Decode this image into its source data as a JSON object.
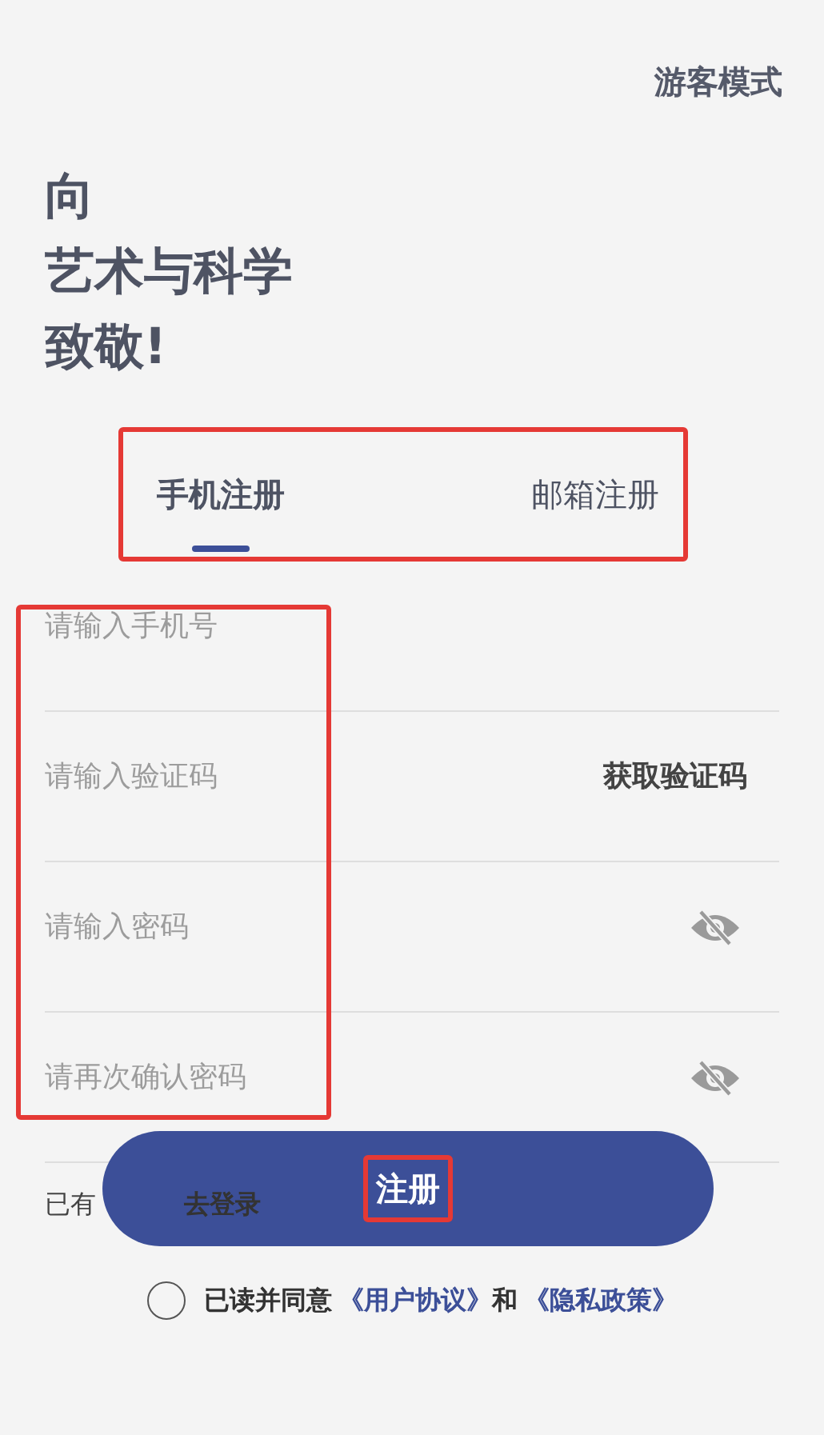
{
  "guest_mode": "游客模式",
  "headline": [
    "向",
    "艺术与科学",
    "致敬!"
  ],
  "tabs_highlighted": true,
  "tabs": [
    {
      "label": "手机注册",
      "selected": true
    },
    {
      "label": "邮箱注册",
      "selected": false
    }
  ],
  "fields_highlighted": true,
  "fields": [
    {
      "kind": "text",
      "placeholder": "请输入手机号"
    },
    {
      "kind": "code",
      "placeholder": "请输入验证码",
      "action": "获取验证码"
    },
    {
      "kind": "password",
      "placeholder": "请输入密码"
    },
    {
      "kind": "password",
      "placeholder": "请再次确认密码"
    }
  ],
  "login_prompt": "已有",
  "login_link": "去登录",
  "register_button": {
    "label": "注册",
    "highlighted": true
  },
  "agreement": {
    "checked": false,
    "text": "已读并同意",
    "link_1": "《用户协议》",
    "conjunction": "和",
    "link_2": "《隐私政策》"
  }
}
